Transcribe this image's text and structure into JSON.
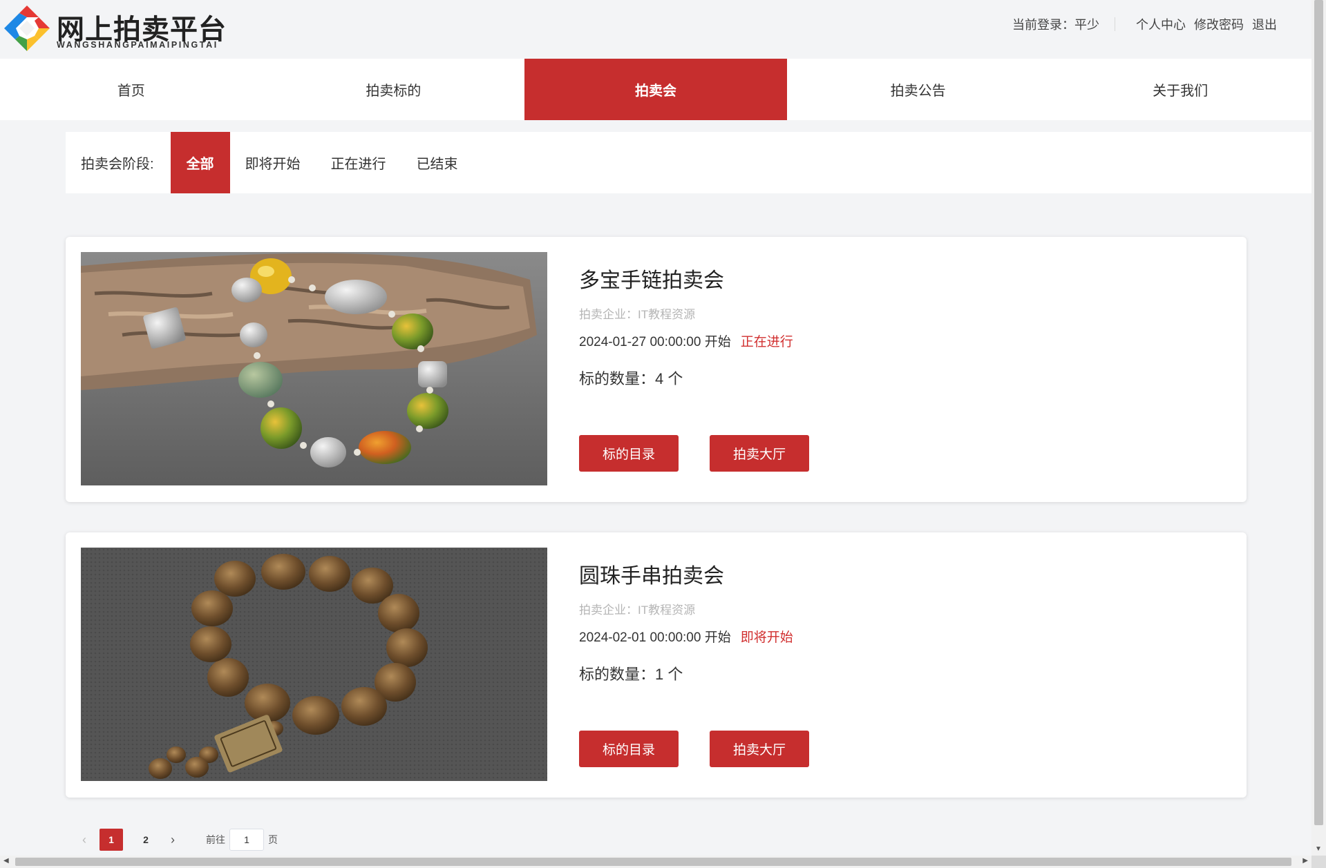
{
  "header": {
    "logo_title": "网上拍卖平台",
    "logo_subtitle": "WANGSHANGPAIMAIPINGTAI",
    "login_label": "当前登录：平少",
    "links": [
      "个人中心",
      "修改密码",
      "退出"
    ]
  },
  "nav": {
    "items": [
      "首页",
      "拍卖标的",
      "拍卖会",
      "拍卖公告",
      "关于我们"
    ],
    "active_index": 2
  },
  "filter": {
    "label": "拍卖会阶段:",
    "options": [
      "全部",
      "即将开始",
      "正在进行",
      "已结束"
    ],
    "active_index": 0
  },
  "auctions": [
    {
      "title": "多宝手链拍卖会",
      "company": "拍卖企业：IT教程资源",
      "start_time": "2024-01-27 00:00:00 开始",
      "status": "正在进行",
      "count": "标的数量：4 个",
      "btn_catalog": "标的目录",
      "btn_hall": "拍卖大厅"
    },
    {
      "title": "圆珠手串拍卖会",
      "company": "拍卖企业：IT教程资源",
      "start_time": "2024-02-01 00:00:00 开始",
      "status": "即将开始",
      "count": "标的数量：1 个",
      "btn_catalog": "标的目录",
      "btn_hall": "拍卖大厅"
    }
  ],
  "pagination": {
    "prev": "‹",
    "next": "›",
    "pages": [
      "1",
      "2"
    ],
    "current": "1",
    "goto_prefix": "前往",
    "goto_value": "1",
    "goto_suffix": "页"
  },
  "colors": {
    "accent": "#c62e2e",
    "status": "#d12f2f",
    "page_bg": "#f3f4f6"
  },
  "icons": [
    "logo-diamond-icon",
    "chevron-left-icon",
    "chevron-right-icon"
  ]
}
